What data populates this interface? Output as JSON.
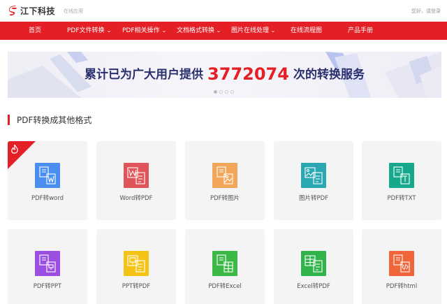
{
  "header": {
    "brand": "江下科技",
    "subtitle": "在线应用",
    "greeting": "您好，请登录",
    "brand_color": "#e41f25"
  },
  "nav": {
    "items": [
      {
        "label": "首页",
        "has_dropdown": false
      },
      {
        "label": "PDF文件转换",
        "has_dropdown": true
      },
      {
        "label": "PDF相关操作",
        "has_dropdown": true
      },
      {
        "label": "文档格式转换",
        "has_dropdown": true
      },
      {
        "label": "图片在线处理",
        "has_dropdown": true
      },
      {
        "label": "在线流程图",
        "has_dropdown": false
      },
      {
        "label": "产品手册",
        "has_dropdown": false
      }
    ]
  },
  "banner": {
    "prefix": "累计已为广大用户提供",
    "count": "3772074",
    "suffix": "次的转换服务",
    "slides": 4,
    "active_slide": 0
  },
  "section": {
    "title": "PDF转换成其他格式"
  },
  "tools": [
    {
      "label": "PDF转word",
      "color": "#4a8ef0",
      "icon": "pdf-to-word-icon",
      "hot": true
    },
    {
      "label": "Word转PDF",
      "color": "#e0555a",
      "icon": "word-to-pdf-icon",
      "hot": false
    },
    {
      "label": "PDF转图片",
      "color": "#f2a65a",
      "icon": "pdf-to-image-icon",
      "hot": false
    },
    {
      "label": "图片转PDF",
      "color": "#2aa7b0",
      "icon": "image-to-pdf-icon",
      "hot": false
    },
    {
      "label": "PDF转TXT",
      "color": "#16a88a",
      "icon": "pdf-to-txt-icon",
      "hot": false
    },
    {
      "label": "PDF转PPT",
      "color": "#9a4fe0",
      "icon": "pdf-to-ppt-icon",
      "hot": false
    },
    {
      "label": "PPT转PDF",
      "color": "#f4c316",
      "icon": "ppt-to-pdf-icon",
      "hot": false
    },
    {
      "label": "PDF转Excel",
      "color": "#3cb846",
      "icon": "pdf-to-excel-icon",
      "hot": false
    },
    {
      "label": "Excel转PDF",
      "color": "#2fb34a",
      "icon": "excel-to-pdf-icon",
      "hot": false
    },
    {
      "label": "PDF转html",
      "color": "#f0653a",
      "icon": "pdf-to-html-icon",
      "hot": false
    }
  ]
}
